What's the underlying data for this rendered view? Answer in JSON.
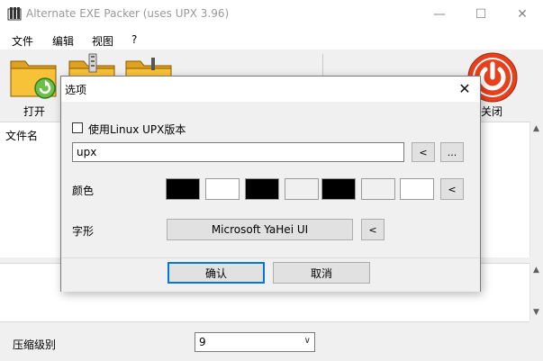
{
  "window": {
    "title": "Alternate EXE Packer (uses UPX 3.96)",
    "controls": {
      "minimize": "—",
      "maximize": "☐",
      "close": "✕"
    }
  },
  "menu": [
    {
      "label": "文件"
    },
    {
      "label": "编辑"
    },
    {
      "label": "视图"
    },
    {
      "label": "?"
    }
  ],
  "toolbar": {
    "open_label": "打开",
    "close_label": "关闭",
    "icons": [
      "open-folder-icon",
      "archive-folder-icon",
      "folder-icon",
      "power-icon"
    ]
  },
  "file_list": {
    "header": "文件名"
  },
  "compression": {
    "label": "压缩级别",
    "value": "9"
  },
  "dialog": {
    "title": "选项",
    "close": "✕",
    "use_linux_upx": {
      "label": "使用Linux UPX版本",
      "checked": false
    },
    "upx_path": {
      "value": "upx"
    },
    "reset_label": "<",
    "browse_label": "...",
    "color_label": "颜色",
    "colors": [
      "#000000",
      "#ffffff",
      "#000000",
      "#f0f0f0",
      "#000000",
      "#f0f0f0",
      "#ffffff"
    ],
    "font_label": "字形",
    "font_value": "Microsoft YaHei UI",
    "ok_label": "确认",
    "cancel_label": "取消"
  },
  "theme": {
    "accent": "#0078d7",
    "power_red": "#e8401c"
  }
}
